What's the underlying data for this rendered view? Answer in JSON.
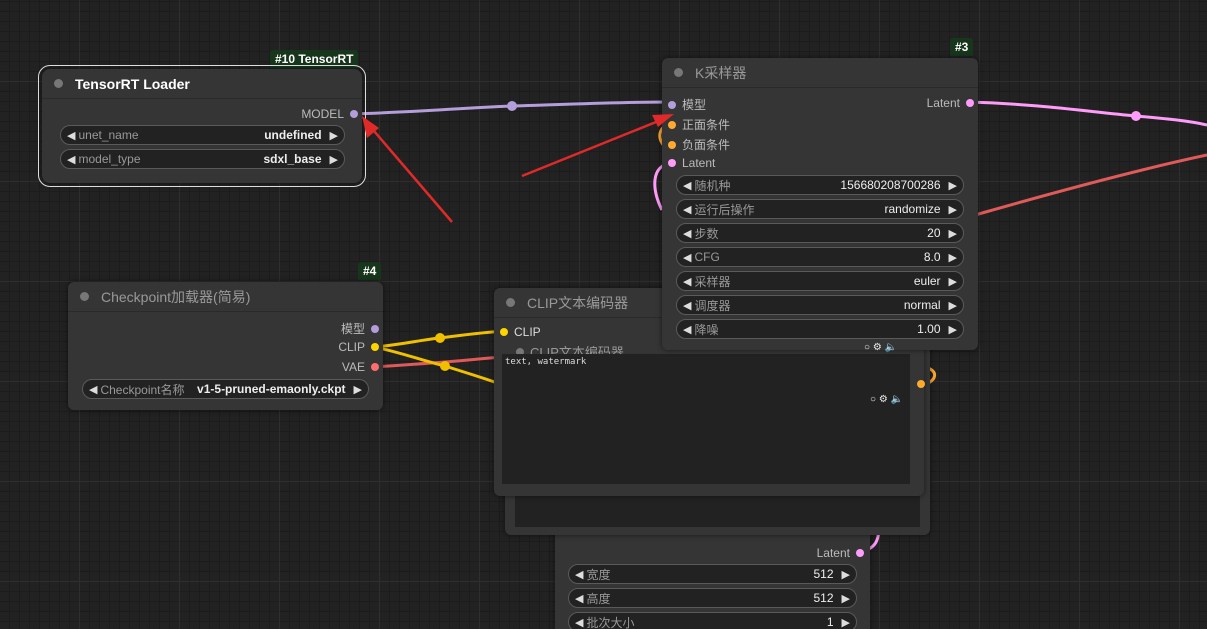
{
  "colors": {
    "model": "#b39ddb",
    "clip": "#ffd500",
    "vae": "#ff6e6e",
    "latent": "#ff9cf9",
    "conditioning": "#ffa931",
    "arrow": "#e02a2a",
    "badge": "#17361c"
  },
  "nodes": {
    "tensorrt_loader": {
      "badge": "#10 TensorRT",
      "title": "TensorRT Loader",
      "output_model": "MODEL",
      "widgets": [
        {
          "label": "unet_name",
          "value": "undefined"
        },
        {
          "label": "model_type",
          "value": "sdxl_base"
        }
      ]
    },
    "ksampler": {
      "badge": "#3",
      "title": "K采样器",
      "inputs": [
        "模型",
        "正面条件",
        "负面条件",
        "Latent"
      ],
      "output_latent": "Latent",
      "widgets": [
        {
          "label": "随机种",
          "value": "156680208700286"
        },
        {
          "label": "运行后操作",
          "value": "randomize"
        },
        {
          "label": "步数",
          "value": "20"
        },
        {
          "label": "CFG",
          "value": "8.0"
        },
        {
          "label": "采样器",
          "value": "euler"
        },
        {
          "label": "调度器",
          "value": "normal"
        },
        {
          "label": "降噪",
          "value": "1.00"
        }
      ]
    },
    "checkpoint": {
      "badge": "#4",
      "title": "Checkpoint加载器(简易)",
      "outputs": [
        "模型",
        "CLIP",
        "VAE"
      ],
      "widget": {
        "label": "Checkpoint名称",
        "value": "v1-5-pruned-emaonly.ckpt"
      }
    },
    "clip_encoder": {
      "title": "CLIP文本编码器",
      "input_clip": "CLIP",
      "partial_title": "CLIP文本编码器",
      "text": "text, watermark"
    },
    "latent_image": {
      "output_latent": "Latent",
      "widgets": [
        {
          "label": "宽度",
          "value": "512"
        },
        {
          "label": "高度",
          "value": "512"
        },
        {
          "label": "批次大小",
          "value": "1"
        }
      ]
    }
  }
}
